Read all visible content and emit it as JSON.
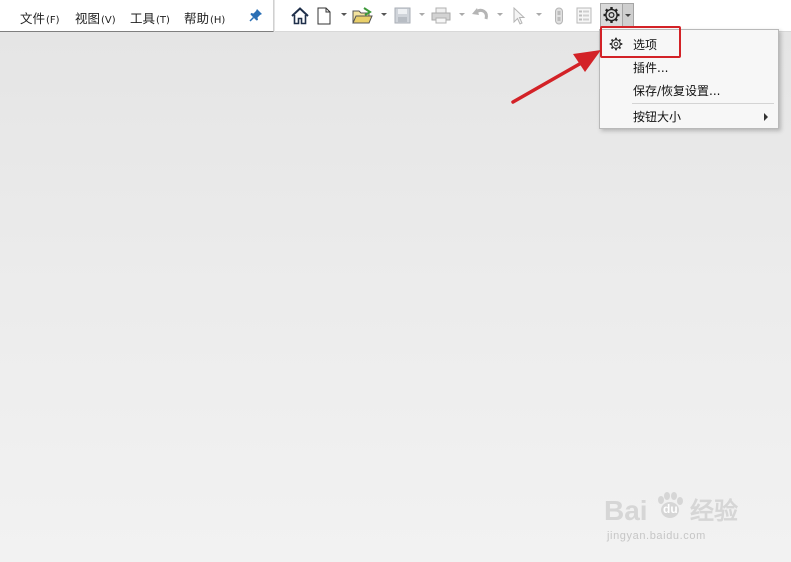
{
  "menubar": {
    "items": [
      {
        "label": "文件",
        "accel": "(F)"
      },
      {
        "label": "视图",
        "accel": "(V)"
      },
      {
        "label": "工具",
        "accel": "(T)"
      },
      {
        "label": "帮助",
        "accel": "(H)"
      }
    ]
  },
  "toolbar": {
    "icons": [
      "home-icon",
      "new-document-icon",
      "open-folder-icon",
      "save-icon",
      "print-icon",
      "undo-icon",
      "select-cursor-icon",
      "rebuild-icon",
      "file-properties-icon",
      "options-gear-icon"
    ]
  },
  "options_menu": {
    "items": [
      {
        "label": "选项"
      },
      {
        "label": "插件..."
      },
      {
        "label": "保存/恢复设置..."
      },
      {
        "label": "按钮大小"
      }
    ]
  },
  "colors": {
    "annotation_red": "#d32227",
    "pin_blue": "#2a6fb5"
  },
  "watermark": {
    "brand_latin_1": "Bai",
    "brand_latin_2": "du",
    "brand_cn": "经验",
    "url": "jingyan.baidu.com"
  }
}
